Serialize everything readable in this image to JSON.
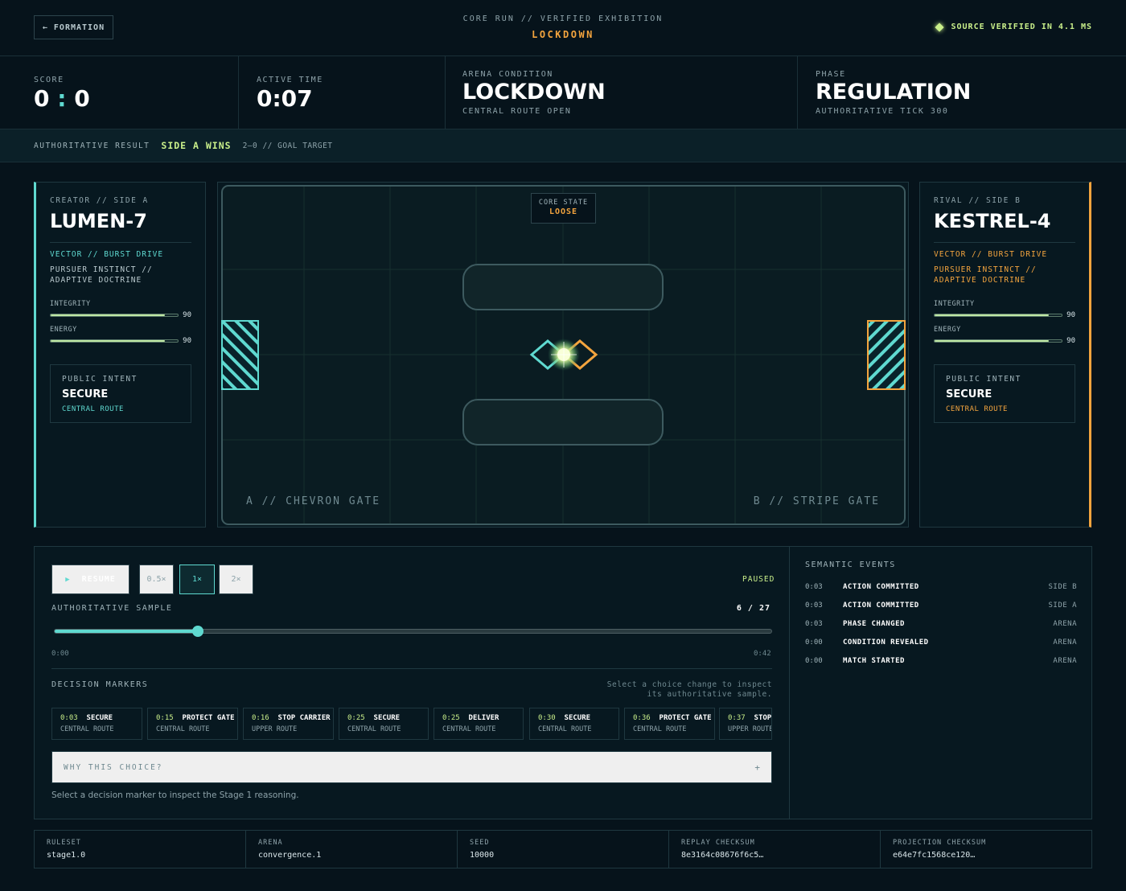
{
  "header": {
    "back_label": "← FORMATION",
    "subtitle": "CORE RUN // VERIFIED EXHIBITION",
    "title": "LOCKDOWN",
    "verified_text": "SOURCE VERIFIED IN 4.1 MS"
  },
  "stats": {
    "score": {
      "label": "SCORE",
      "a": "0",
      "sep": ":",
      "b": "0"
    },
    "active_time": {
      "label": "ACTIVE TIME",
      "value": "0:07"
    },
    "arena_condition": {
      "label": "ARENA CONDITION",
      "value": "LOCKDOWN",
      "detail": "CENTRAL ROUTE OPEN"
    },
    "phase": {
      "label": "PHASE",
      "value": "REGULATION",
      "detail": "AUTHORITATIVE TICK 300"
    }
  },
  "result": {
    "label": "AUTHORITATIVE RESULT",
    "winner": "SIDE A WINS",
    "target": "2–0 // GOAL TARGET"
  },
  "side_a": {
    "tag": "CREATOR // SIDE A",
    "name": "LUMEN-7",
    "vector": "VECTOR // BURST DRIVE",
    "pursuer": "PURSUER INSTINCT // ADAPTIVE DOCTRINE",
    "integrity_label": "INTEGRITY",
    "integrity": 90,
    "integrity_text": "90",
    "energy_label": "ENERGY",
    "energy": 90,
    "energy_text": "90",
    "intent_label": "PUBLIC INTENT",
    "intent_value": "SECURE",
    "intent_route": "CENTRAL ROUTE",
    "color": "#5fd9d0"
  },
  "side_b": {
    "tag": "RIVAL // SIDE B",
    "name": "KESTREL-4",
    "vector": "VECTOR // BURST DRIVE",
    "pursuer": "PURSUER INSTINCT // ADAPTIVE DOCTRINE",
    "integrity_label": "INTEGRITY",
    "integrity": 90,
    "integrity_text": "90",
    "energy_label": "ENERGY",
    "energy": 90,
    "energy_text": "90",
    "intent_label": "PUBLIC INTENT",
    "intent_value": "SECURE",
    "intent_route": "CENTRAL ROUTE",
    "color": "#f3a43e"
  },
  "arena": {
    "core_state_label": "CORE STATE",
    "core_state_value": "LOOSE",
    "gate_a": "A // CHEVRON GATE",
    "gate_b": "B // STRIPE GATE"
  },
  "replay": {
    "resume_label": "RESUME",
    "speeds": [
      "0.5×",
      "1×",
      "2×"
    ],
    "active_speed": "1×",
    "status": "PAUSED",
    "sample_label": "AUTHORITATIVE SAMPLE",
    "sample_value": "6 / 27",
    "progress": 0.2,
    "time_start": "0:00",
    "time_end": "0:42",
    "markers_label": "DECISION MARKERS",
    "markers_hint": "Select a choice change to inspect its authoritative sample.",
    "markers": [
      {
        "time": "0:03",
        "action": "SECURE",
        "route": "CENTRAL ROUTE"
      },
      {
        "time": "0:15",
        "action": "PROTECT GATE",
        "route": "CENTRAL ROUTE"
      },
      {
        "time": "0:16",
        "action": "STOP CARRIER",
        "route": "UPPER ROUTE"
      },
      {
        "time": "0:25",
        "action": "SECURE",
        "route": "CENTRAL ROUTE"
      },
      {
        "time": "0:25",
        "action": "DELIVER",
        "route": "CENTRAL ROUTE"
      },
      {
        "time": "0:30",
        "action": "SECURE",
        "route": "CENTRAL ROUTE"
      },
      {
        "time": "0:36",
        "action": "PROTECT GATE",
        "route": "CENTRAL ROUTE"
      },
      {
        "time": "0:37",
        "action": "STOP",
        "route": "UPPER ROUTE"
      }
    ],
    "why_label": "WHY THIS CHOICE?",
    "why_plus": "+",
    "why_hint": "Select a decision marker to inspect the Stage 1 reasoning."
  },
  "events": {
    "title": "SEMANTIC EVENTS",
    "items": [
      {
        "time": "0:03",
        "name": "ACTION COMMITTED",
        "side": "SIDE B"
      },
      {
        "time": "0:03",
        "name": "ACTION COMMITTED",
        "side": "SIDE A"
      },
      {
        "time": "0:03",
        "name": "PHASE CHANGED",
        "side": "ARENA"
      },
      {
        "time": "0:00",
        "name": "CONDITION REVEALED",
        "side": "ARENA"
      },
      {
        "time": "0:00",
        "name": "MATCH STARTED",
        "side": "ARENA"
      }
    ]
  },
  "footer": [
    {
      "label": "RULESET",
      "value": "stage1.0"
    },
    {
      "label": "ARENA",
      "value": "convergence.1"
    },
    {
      "label": "SEED",
      "value": "10000"
    },
    {
      "label": "REPLAY CHECKSUM",
      "value": "8e3164c08676f6c5…"
    },
    {
      "label": "PROJECTION CHECKSUM",
      "value": "e64e7fc1568ce120…"
    }
  ],
  "colors": {
    "accent_a": "#5fd9d0",
    "accent_b": "#f3a43e",
    "success": "#c9ef8a",
    "background": "#06131b"
  }
}
